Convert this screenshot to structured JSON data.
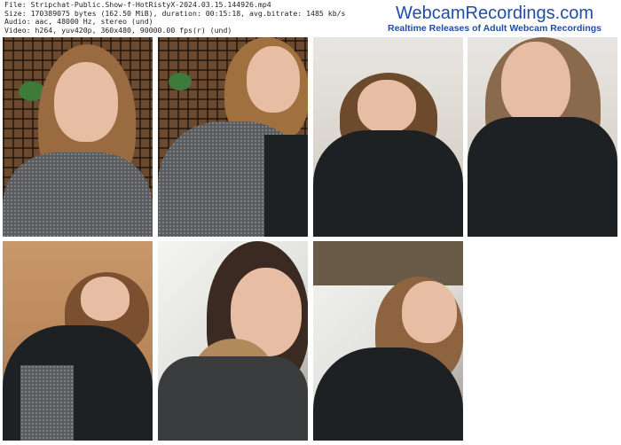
{
  "header": {
    "file_line": "File: Stripchat-Public.Show-f-HotRistyX-2024.03.15.144926.mp4",
    "size_line": "Size: 170389075 bytes (162.50 MiB), duration: 00:15:18, avg.bitrate: 1485 kb/s",
    "audio_line": "Audio: aac, 48000 Hz, stereo (und)",
    "video_line": "Video: h264, yuv420p, 360x480, 90000.00 fps(r) (und)"
  },
  "brand": {
    "title": "WebcamRecordings.com",
    "tagline": "Realtime Releases of Adult Webcam Recordings"
  },
  "thumbnails": [
    {
      "scene": "lattice-ceiling, grey sweater, necklace"
    },
    {
      "scene": "lattice-ceiling, grey sweater, low angle"
    },
    {
      "scene": "white ceiling, black puffer jacket"
    },
    {
      "scene": "light ceiling, black puffer jacket"
    },
    {
      "scene": "wood ceiling, black jacket, low angle"
    },
    {
      "scene": "window, black jacket, smiling"
    },
    {
      "scene": "window, dark jacket, low angle"
    }
  ]
}
